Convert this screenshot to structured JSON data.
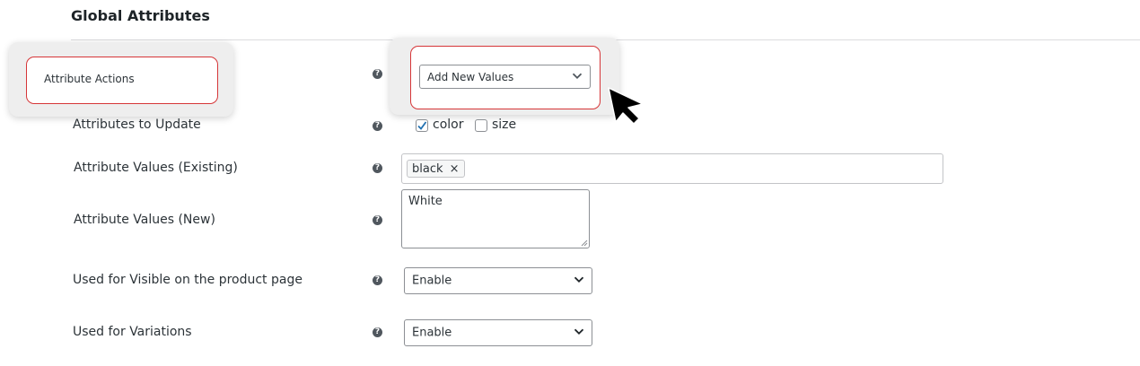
{
  "section": {
    "title": "Global Attributes"
  },
  "rows": {
    "attribute_actions": {
      "label": "Attribute Actions",
      "help": "?",
      "selected": "Add New Values"
    },
    "attributes_to_update": {
      "label": "Attributes to Update",
      "help": "?",
      "options": [
        {
          "label": "color",
          "checked": true
        },
        {
          "label": "size",
          "checked": false
        }
      ]
    },
    "values_existing": {
      "label": "Attribute Values (Existing)",
      "help": "?",
      "tags": [
        {
          "label": "black",
          "remove": "×"
        }
      ]
    },
    "values_new": {
      "label": "Attribute Values (New)",
      "help": "?",
      "value": "White"
    },
    "visible_product_page": {
      "label": "Used for Visible on the product page",
      "help": "?",
      "selected": "Enable"
    },
    "used_for_variations": {
      "label": "Used for Variations",
      "help": "?",
      "selected": "Enable"
    }
  },
  "colors": {
    "highlight_border": "#d63638",
    "checkbox_check": "#2271b1",
    "highlight_card_bg": "#eeeeee"
  },
  "icons": {
    "help": "question-circle-icon",
    "chevron": "chevron-down-icon",
    "checkmark": "checkmark-icon",
    "tag_remove": "close-icon",
    "cursor": "mouse-pointer-icon"
  }
}
